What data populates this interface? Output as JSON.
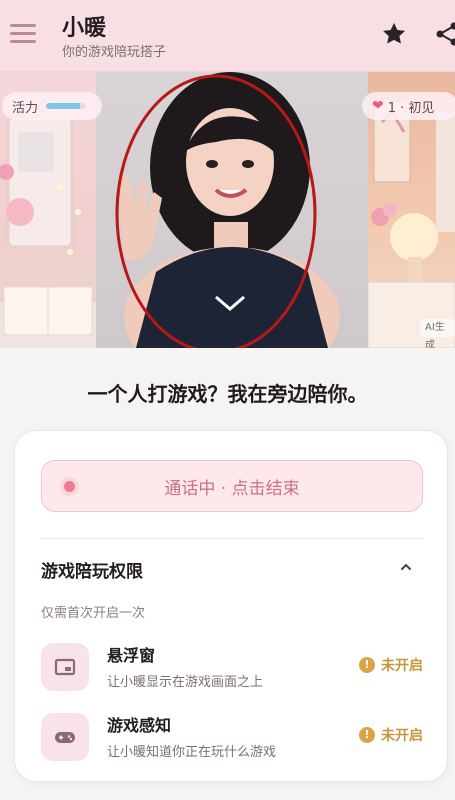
{
  "header": {
    "title": "小暖",
    "subtitle": "你的游戏陪玩搭子",
    "menu_icon": "hamburger-menu-icon",
    "favorite_icon": "star-icon",
    "share_icon": "share-icon"
  },
  "hero": {
    "energy_label": "活力",
    "energy_level": 0.85,
    "level_label": "1 · 初见",
    "ai_badge": "AI生成",
    "colors": {
      "energy_bar": "#7ec8e6",
      "heart": "#e85a87"
    }
  },
  "tagline": "一个人打游戏？我在旁边陪你。",
  "call": {
    "label": "通话中 · 点击结束",
    "status_color": "#ef7a92"
  },
  "permissions": {
    "title": "游戏陪玩权限",
    "subtitle": "仅需首次开启一次",
    "items": [
      {
        "name": "悬浮窗",
        "desc": "让小暖显示在游戏画面之上",
        "status": "未开启",
        "icon": "floating-window-icon"
      },
      {
        "name": "游戏感知",
        "desc": "让小暖知道你正在玩什么游戏",
        "status": "未开启",
        "icon": "gamepad-icon"
      }
    ],
    "status_color": "#c7953a"
  }
}
